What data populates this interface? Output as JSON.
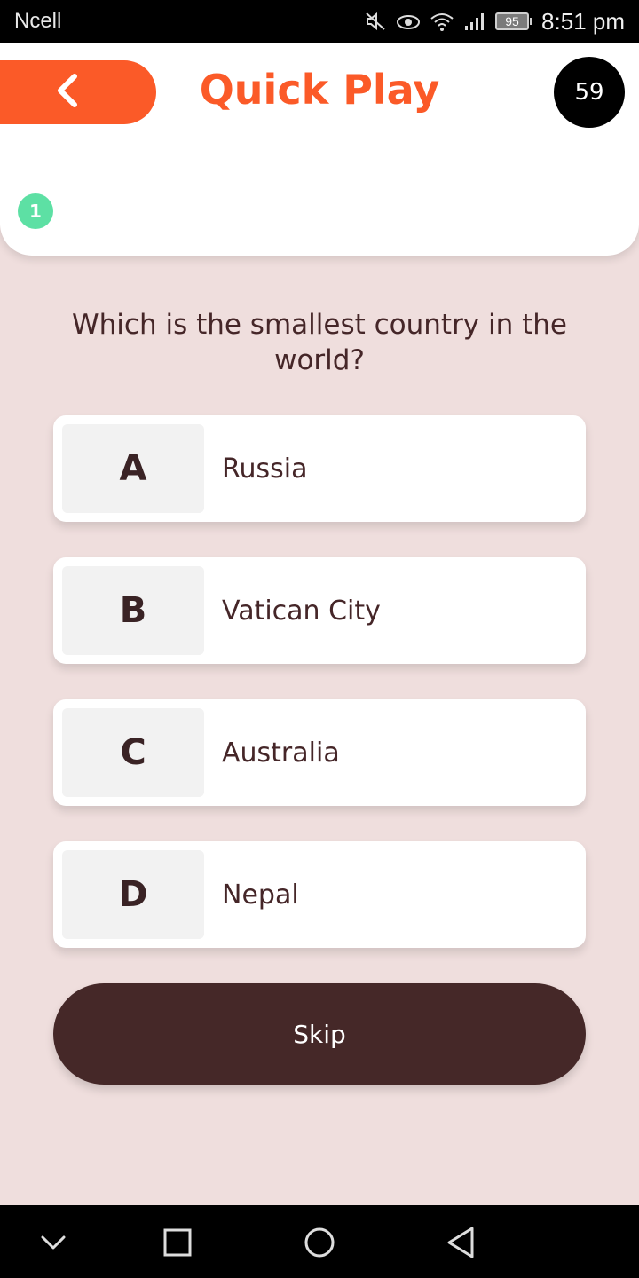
{
  "status_bar": {
    "carrier": "Ncell",
    "battery": "95",
    "time": "8:51 pm",
    "icons": [
      "mute-icon",
      "eye-icon",
      "wifi-icon",
      "signal-icon",
      "battery-icon"
    ]
  },
  "header": {
    "title": "Quick Play",
    "timer": "59",
    "question_number": "1",
    "back_icon": "chevron-left-icon"
  },
  "question": {
    "text": "Which is the smallest country in the world?"
  },
  "options": [
    {
      "letter": "A",
      "text": "Russia"
    },
    {
      "letter": "B",
      "text": "Vatican City"
    },
    {
      "letter": "C",
      "text": "Australia"
    },
    {
      "letter": "D",
      "text": "Nepal"
    }
  ],
  "skip_label": "Skip",
  "nav_bar": {
    "icons": [
      "chevron-down-icon",
      "square-icon",
      "circle-icon",
      "triangle-back-icon"
    ]
  },
  "colors": {
    "accent": "#fb5a28",
    "background": "#efdedd",
    "dark": "#452828",
    "question_badge": "#5de0a4"
  }
}
